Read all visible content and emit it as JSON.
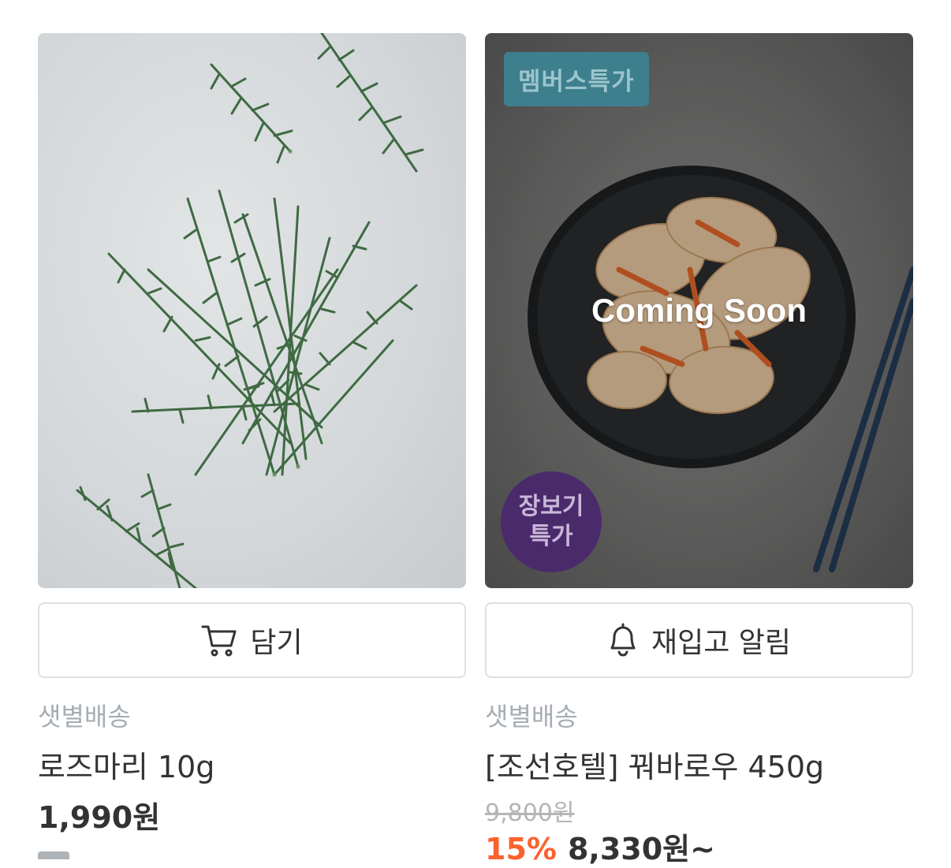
{
  "products": [
    {
      "image": "rosemary-photo",
      "button": {
        "icon": "cart-icon",
        "label": "담기"
      },
      "delivery": "샛별배송",
      "name": "로즈마리 10g",
      "price": "1,990원"
    },
    {
      "image": "sweet-and-sour-pork-photo",
      "member_badge": "멤버스특가",
      "status_overlay": "Coming Soon",
      "circle_badge": {
        "line1": "장보기",
        "line2": "특가"
      },
      "button": {
        "icon": "bell-icon",
        "label": "재입고 알림"
      },
      "delivery": "샛별배송",
      "name": "[조선호텔] 꿔바로우 450g",
      "original_price": "9,800원",
      "discount": "15%",
      "sale_price": "8,330원~"
    }
  ],
  "colors": {
    "discount": "#fa622f",
    "member_badge_bg": "#3e7f8e",
    "circle_badge_bg": "#4b2a6c",
    "muted_text": "#a6adb4",
    "border": "#dde0e3"
  }
}
